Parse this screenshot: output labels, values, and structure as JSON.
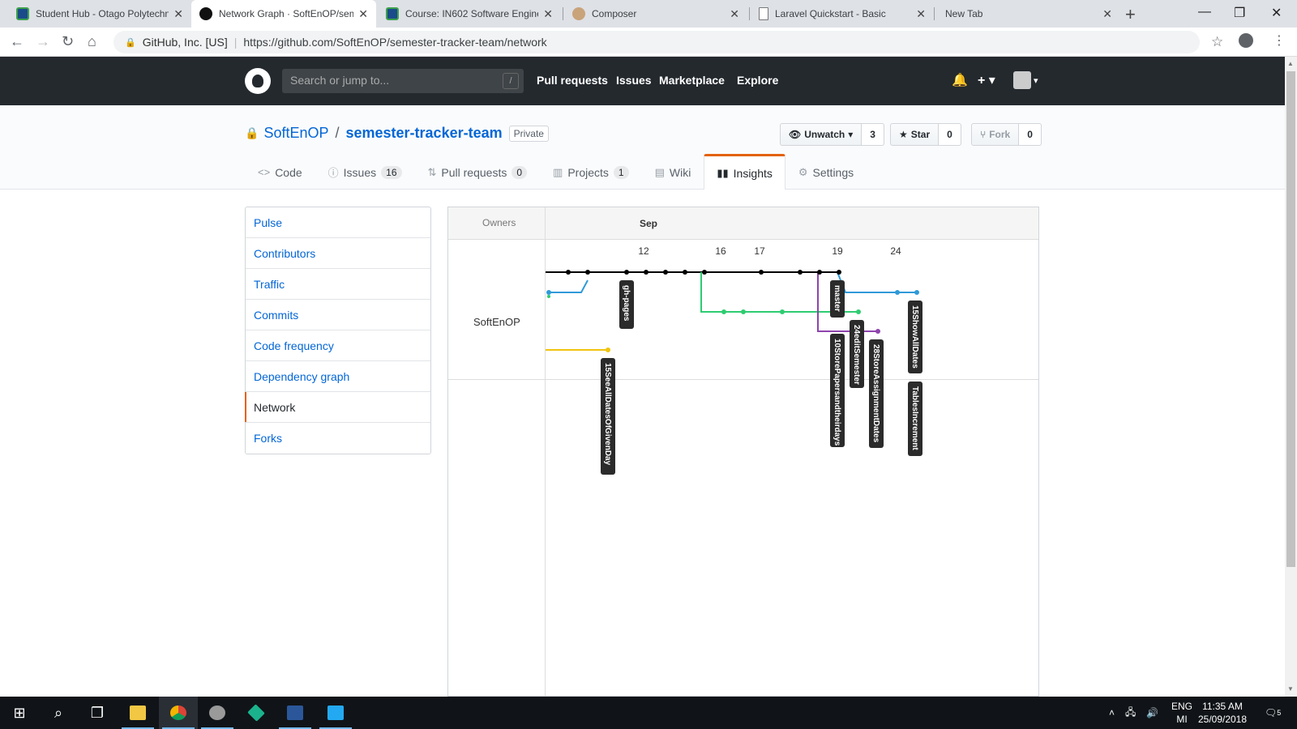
{
  "browser": {
    "tabs": [
      {
        "title": "Student Hub - Otago Polytechnic",
        "icon": "otago-icon"
      },
      {
        "title": "Network Graph · SoftEnOP/semester-tracker-team",
        "icon": "github-icon"
      },
      {
        "title": "Course: IN602 Software Engineering",
        "icon": "otago-icon"
      },
      {
        "title": "Composer",
        "icon": "composer-icon"
      },
      {
        "title": "Laravel Quickstart - Basic",
        "icon": "document-icon"
      },
      {
        "title": "New Tab",
        "icon": ""
      }
    ],
    "active_tab": 1,
    "site_identity": "GitHub, Inc. [US]",
    "url": "https://github.com/SoftEnOP/semester-tracker-team/network"
  },
  "github_header": {
    "search_placeholder": "Search or jump to...",
    "search_shortcut": "/",
    "nav": [
      "Pull requests",
      "Issues",
      "Marketplace",
      "Explore"
    ]
  },
  "repo": {
    "owner": "SoftEnOP",
    "separator": "/",
    "name": "semester-tracker-team",
    "visibility": "Private",
    "watch": {
      "label": "Unwatch",
      "count": "3"
    },
    "star": {
      "label": "Star",
      "count": "0"
    },
    "fork": {
      "label": "Fork",
      "count": "0"
    },
    "tabs": [
      {
        "label": "Code",
        "icon": "code-icon",
        "count": ""
      },
      {
        "label": "Issues",
        "icon": "issue-icon",
        "count": "16"
      },
      {
        "label": "Pull requests",
        "icon": "pull-request-icon",
        "count": "0"
      },
      {
        "label": "Projects",
        "icon": "project-icon",
        "count": "1"
      },
      {
        "label": "Wiki",
        "icon": "book-icon",
        "count": ""
      },
      {
        "label": "Insights",
        "icon": "graph-icon",
        "count": ""
      },
      {
        "label": "Settings",
        "icon": "gear-icon",
        "count": ""
      }
    ],
    "selected_tab": "Insights"
  },
  "insights_menu": {
    "items": [
      "Pulse",
      "Contributors",
      "Traffic",
      "Commits",
      "Code frequency",
      "Dependency graph",
      "Network",
      "Forks"
    ],
    "selected": "Network"
  },
  "network": {
    "owners_label": "Owners",
    "month": "Sep",
    "owner": "SoftEnOP",
    "days": [
      "12",
      "16",
      "17",
      "19",
      "24"
    ],
    "branches": [
      "gh-pages",
      "master",
      "15SeeAllDatesOfGivenDay",
      "10StorePapersandtheirdays",
      "24editSemester",
      "28StoreAssignmentDates",
      "15ShowAllDates",
      "TablesIncrement"
    ],
    "colors": {
      "master": "#000000",
      "blue": "#2f9ad8",
      "green": "#2ecc71",
      "purple": "#8e44ad",
      "yellow": "#f1c40f",
      "label_bg": "#2b2b2b"
    }
  },
  "taskbar": {
    "language": [
      "ENG",
      "MI"
    ],
    "time": "11:35 AM",
    "date": "25/09/2018",
    "notifications": "5"
  }
}
